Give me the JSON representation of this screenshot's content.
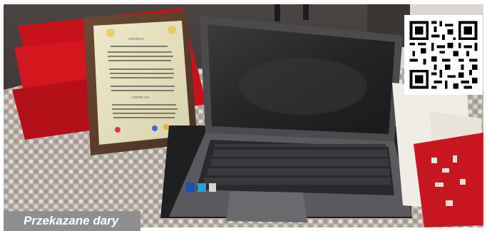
{
  "photo": {
    "description_icon": "photo-of-laptop-and-certificate",
    "plaque": {
      "heading_1": "CERTIFIKÁT",
      "heading_2": "CERTIFICATE"
    }
  },
  "qr_code": {
    "icon": "qr-code-icon"
  },
  "caption": {
    "text": "Przekazane dary"
  }
}
